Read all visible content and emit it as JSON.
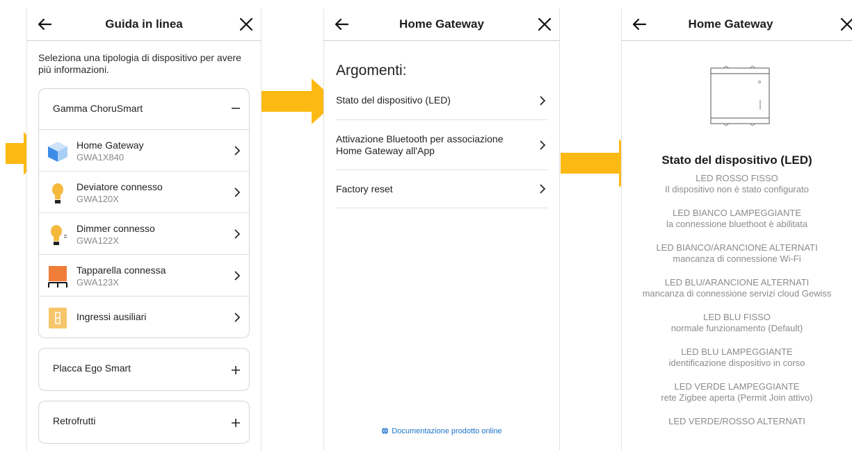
{
  "screen1": {
    "title": "Guida in linea",
    "intro": "Seleziona una tipologia di dispositivo per avere più informazioni.",
    "groups": [
      {
        "label": "Gamma ChoruSmart",
        "expanded_icon": "minus-icon",
        "devices": [
          {
            "name": "Home Gateway",
            "code": "GWA1X840",
            "icon": "gateway-cube-icon"
          },
          {
            "name": "Deviatore connesso",
            "code": "GWA120X",
            "icon": "bulb-icon"
          },
          {
            "name": "Dimmer connesso",
            "code": "GWA122X",
            "icon": "bulb-dimmer-icon"
          },
          {
            "name": "Tapparella connessa",
            "code": "GWA123X",
            "icon": "shutter-icon"
          },
          {
            "name": "Ingressi ausiliari",
            "code": "",
            "icon": "aux-input-icon"
          }
        ]
      },
      {
        "label": "Placca Ego Smart",
        "expanded_icon": "plus-icon"
      },
      {
        "label": "Retrofrutti",
        "expanded_icon": "plus-icon"
      }
    ]
  },
  "screen2": {
    "title": "Home Gateway",
    "heading": "Argomenti:",
    "topics": [
      {
        "label": "Stato del dispositivo (LED)"
      },
      {
        "label": "Attivazione Bluetooth per associazione Home Gateway all'App"
      },
      {
        "label": "Factory reset"
      }
    ],
    "doc_link": "Documentazione prodotto online"
  },
  "screen3": {
    "title": "Home Gateway",
    "section_title": "Stato del dispositivo (LED)",
    "leds": [
      {
        "state": "LED ROSSO FISSO",
        "desc": "Il dispositivo non è stato configurato"
      },
      {
        "state": "LED BIANCO LAMPEGGIANTE",
        "desc": "la connessione bluethoot è abilitata"
      },
      {
        "state": "LED BIANCO/ARANCIONE ALTERNATI",
        "desc": "mancanza di connessione Wi-Fi"
      },
      {
        "state": "LED BLU/ARANCIONE ALTERNATI",
        "desc": "mancanza di connessione servizi cloud Gewiss"
      },
      {
        "state": "LED BLU FISSO",
        "desc": "normale funzionamento (Default)"
      },
      {
        "state": "LED BLU LAMPEGGIANTE",
        "desc": "identificazione dispositivo in corso"
      },
      {
        "state": "LED VERDE LAMPEGGIANTE",
        "desc": "rete Zigbee aperta (Permit Join attivo)"
      },
      {
        "state": "LED VERDE/ROSSO ALTERNATI",
        "desc": ""
      }
    ]
  },
  "colors": {
    "arrow": "#FDB913",
    "link": "#1a73c8",
    "muted_text": "#8b8b8b",
    "border": "#d4d4d4"
  }
}
